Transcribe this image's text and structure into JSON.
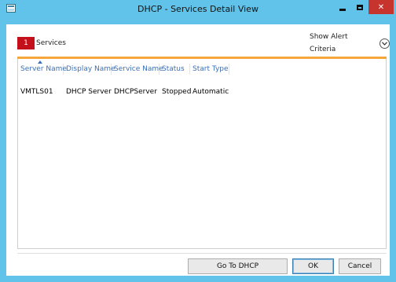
{
  "window": {
    "title": "DHCP - Services Detail View",
    "controls": {
      "minimize": "minimize",
      "maximize": "maximize",
      "close": "✕"
    }
  },
  "header": {
    "count": "1",
    "section_label": "Services",
    "alert_criteria_label": "Show Alert Criteria"
  },
  "table": {
    "columns": [
      "Server Name",
      "Display Name",
      "Service Name",
      "Status",
      "Start Type"
    ],
    "rows": [
      [
        "VMTLS01",
        "DHCP Server",
        "DHCPServer",
        "Stopped",
        "Automatic"
      ]
    ]
  },
  "footer": {
    "goto_label": "Go To DHCP",
    "ok_label": "OK",
    "cancel_label": "Cancel"
  },
  "colors": {
    "title_bar": "#62c3ea",
    "badge": "#c4101a",
    "accent_rule": "#f6a73b",
    "column_header_text": "#3b6fb6",
    "close_button": "#c7342d"
  }
}
